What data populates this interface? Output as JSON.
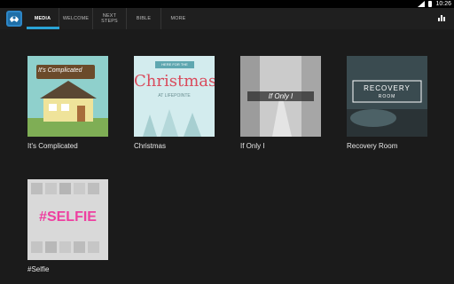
{
  "status": {
    "time": "10:26"
  },
  "tabs": [
    {
      "label": "MEDIA"
    },
    {
      "label": "WELCOME"
    },
    {
      "label": "NEXT\nSTEPS"
    },
    {
      "label": "BIBLE"
    },
    {
      "label": "MORE"
    }
  ],
  "series": [
    {
      "title": "It's Complicated",
      "art_text": "It's Complicated"
    },
    {
      "title": "Christmas",
      "art_text": "Christmas",
      "art_top": "HERE FOR THE",
      "art_sub": "AT LIFEPOINTE"
    },
    {
      "title": "If Only I",
      "art_text": "If Only I"
    },
    {
      "title": "Recovery Room",
      "art_text": "RECOVERY",
      "art_sub": "ROOM"
    },
    {
      "title": "#Selfie",
      "art_text": "#SELFIE"
    }
  ],
  "colors": {
    "accent": "#29a3d6",
    "background": "#1b1b1b",
    "appbar": "#1f1f1f"
  },
  "icons": {
    "logo": "church-logo-icon",
    "chart": "bar-chart-icon",
    "signal": "signal-icon",
    "battery": "battery-icon"
  }
}
